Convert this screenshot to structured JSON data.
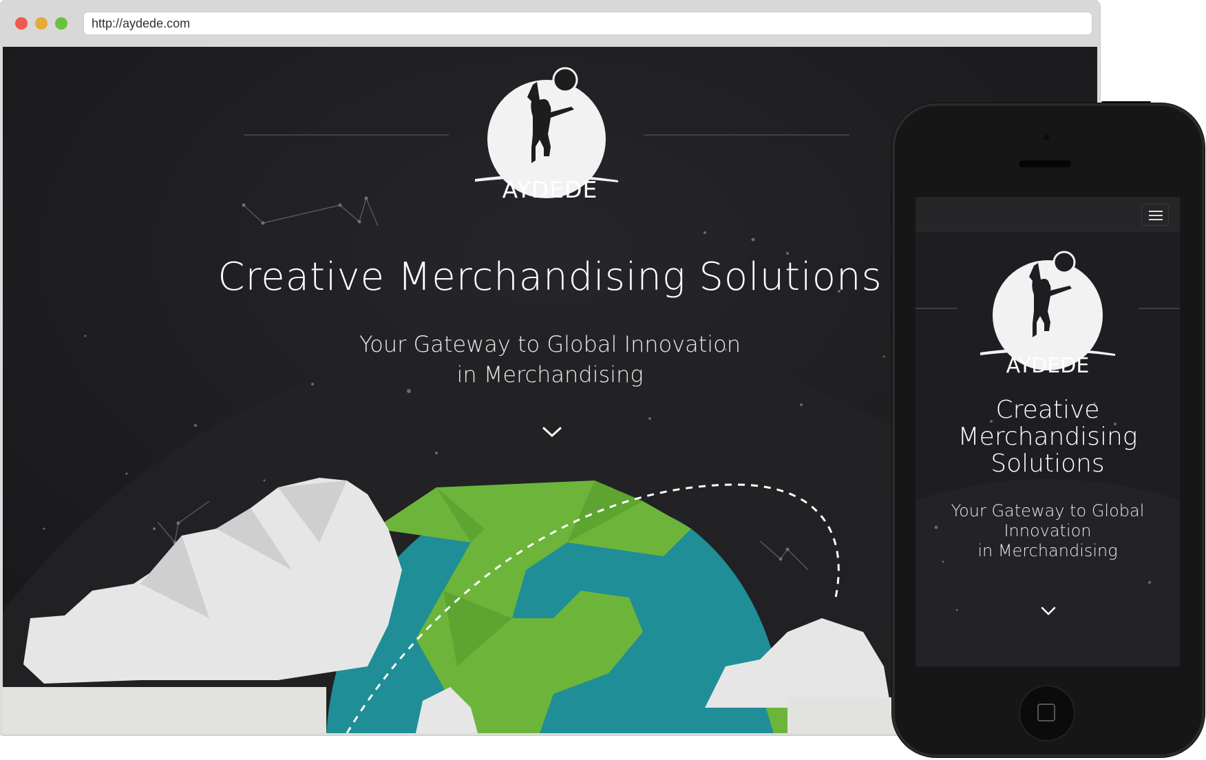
{
  "browser": {
    "url": "http://aydede.com",
    "traffic_lights": [
      "close-dot",
      "minimize-dot",
      "maximize-dot"
    ]
  },
  "desktop_site": {
    "brand": "AYDEDE",
    "title": "Creative Merchandising Solutions",
    "subtitle_lines": [
      "Your Gateway to Global Innovation",
      "in Merchandising"
    ],
    "scroll_icon": "chevron-down-icon"
  },
  "mobile_site": {
    "menu_icon": "hamburger-menu-icon",
    "brand": "AYDEDE",
    "title_lines": [
      "Creative",
      "Merchandising",
      "Solutions"
    ],
    "subtitle_lines": [
      "Your Gateway to Global",
      "Innovation",
      "in Merchandising"
    ],
    "scroll_icon": "chevron-down-icon"
  },
  "colors": {
    "background": "#1d1d20",
    "globe_ocean": "#1f8e96",
    "globe_land": "#6db53a",
    "clouds": "#e4e4e4",
    "text": "#ffffff"
  }
}
